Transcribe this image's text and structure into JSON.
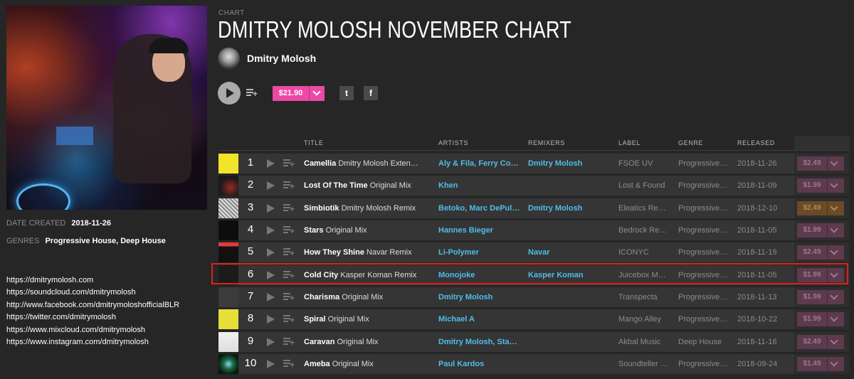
{
  "chart": {
    "section_label": "CHART",
    "title": "DMITRY MOLOSH NOVEMBER CHART",
    "artist": "Dmitry Molosh",
    "price": "$21.90",
    "share": {
      "twitter_icon": "twitter-icon",
      "twitter_glyph": "t",
      "facebook_icon": "facebook-icon",
      "facebook_glyph": "f"
    }
  },
  "meta": {
    "date_created_label": "DATE CREATED",
    "date_created": "2018-11-26",
    "genres_label": "GENRES",
    "genres": "Progressive House, Deep House"
  },
  "links": [
    "https://dmitrymolosh.com",
    "https://soundcloud.com/dmitrymolosh",
    "http://www.facebook.com/dmitrymoloshofficialBLR",
    "https://twitter.com/dmitrymolosh",
    "https://www.mixcloud.com/dmitrymolosh",
    "https://www.instagram.com/dmitrymolosh"
  ],
  "columns": {
    "title": "TITLE",
    "artists": "ARTISTS",
    "remixers": "REMIXERS",
    "label": "LABEL",
    "genre": "GENRE",
    "released": "RELEASED"
  },
  "colors": {
    "accent_pink": "#ec49a6",
    "link_blue": "#50bde8",
    "highlight_red": "#e0201e"
  },
  "tracks": [
    {
      "num": "1",
      "title": "Camellia",
      "mix": "Dmitry Molosh Exten…",
      "artists": "Aly & Fila, Ferry Co…",
      "remixers": "Dmitry Molosh",
      "label": "FSOE UV",
      "genre": "Progressive …",
      "released": "2018-11-26",
      "price": "$2.49"
    },
    {
      "num": "2",
      "title": "Lost Of The Time",
      "mix": "Original Mix",
      "artists": "Khen",
      "remixers": "",
      "label": "Lost & Found",
      "genre": "Progressive …",
      "released": "2018-11-09",
      "price": "$1.99"
    },
    {
      "num": "3",
      "title": "Simbiotik",
      "mix": "Dmitry Molosh Remix",
      "artists": "Betoko, Marc DePulse",
      "remixers": "Dmitry Molosh",
      "label": "Eleatics Rec…",
      "genre": "Progressive …",
      "released": "2018-12-10",
      "price": "$2.49"
    },
    {
      "num": "4",
      "title": "Stars",
      "mix": "Original Mix",
      "artists": "Hannes Bieger",
      "remixers": "",
      "label": "Bedrock Re…",
      "genre": "Progressive …",
      "released": "2018-11-05",
      "price": "$1.99"
    },
    {
      "num": "5",
      "title": "How They Shine",
      "mix": "Navar Remix",
      "artists": "Li-Polymer",
      "remixers": "Navar",
      "label": "ICONYC",
      "genre": "Progressive …",
      "released": "2018-11-19",
      "price": "$2.49"
    },
    {
      "num": "6",
      "title": "Cold City",
      "mix": "Kasper Koman Remix",
      "artists": "Monojoke",
      "remixers": "Kasper Koman",
      "label": "Juicebox M…",
      "genre": "Progressive …",
      "released": "2018-11-05",
      "price": "$1.99"
    },
    {
      "num": "7",
      "title": "Charisma",
      "mix": "Original Mix",
      "artists": "Dmitry Molosh",
      "remixers": "",
      "label": "Transpecta",
      "genre": "Progressive …",
      "released": "2018-11-13",
      "price": "$1.99"
    },
    {
      "num": "8",
      "title": "Spiral",
      "mix": "Original Mix",
      "artists": "Michael A",
      "remixers": "",
      "label": "Mango Alley",
      "genre": "Progressive …",
      "released": "2018-10-22",
      "price": "$1.99"
    },
    {
      "num": "9",
      "title": "Caravan",
      "mix": "Original Mix",
      "artists": "Dmitry Molosh, Sta…",
      "remixers": "",
      "label": "Akbal Music",
      "genre": "Deep House",
      "released": "2018-11-16",
      "price": "$2.49"
    },
    {
      "num": "10",
      "title": "Ameba",
      "mix": "Original Mix",
      "artists": "Paul Kardos",
      "remixers": "",
      "label": "Soundteller …",
      "genre": "Progressive …",
      "released": "2018-09-24",
      "price": "$1.49"
    }
  ]
}
